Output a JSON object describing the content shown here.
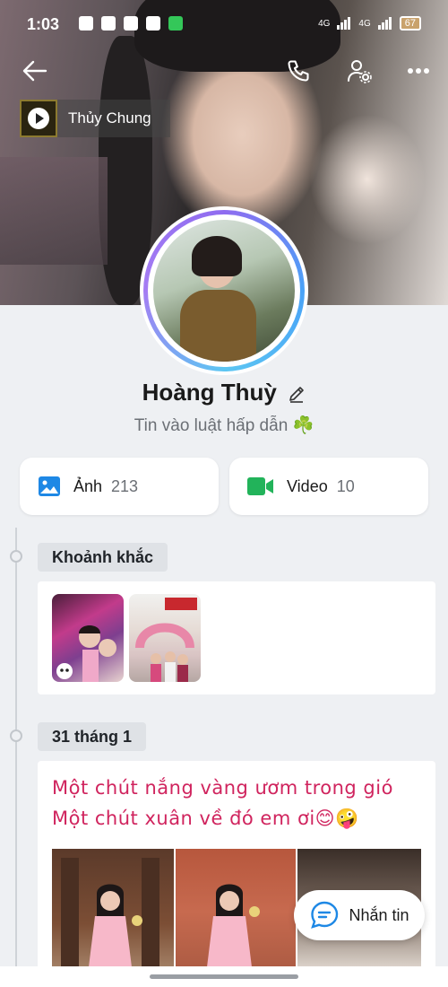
{
  "status_bar": {
    "time": "1:03",
    "signal_left": "4G",
    "signal_right": "4G",
    "battery": "67"
  },
  "music": {
    "title": "Thủy Chung",
    "thumb_label": "Chung"
  },
  "profile": {
    "name": "Hoàng Thuỳ",
    "bio": "Tin vào luật hấp dẫn ☘️"
  },
  "media": {
    "photos": {
      "label": "Ảnh",
      "count": "213",
      "color": "#1e88e5"
    },
    "videos": {
      "label": "Video",
      "count": "10",
      "color": "#22b35a"
    }
  },
  "moments": {
    "title": "Khoảnh khắc"
  },
  "post": {
    "date": "31 tháng 1",
    "line1": "Một chút nắng vàng ươm trong gió",
    "line2": "Một chút xuân về đó em ơi😊🤪"
  },
  "message_button": {
    "label": "Nhắn tin",
    "color": "#1e88e5"
  }
}
